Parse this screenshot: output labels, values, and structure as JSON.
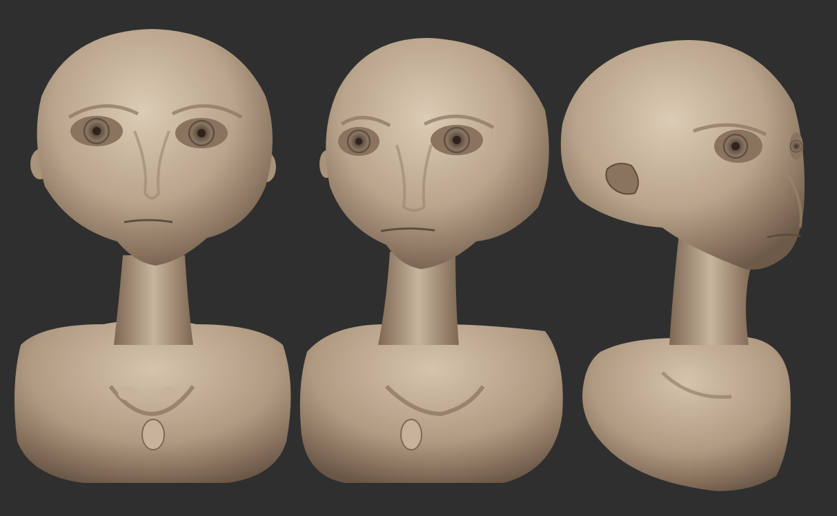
{
  "scene": {
    "background_color": "#2f2f2f",
    "clay_color": "#b9a48c",
    "clay_highlight": "#d8c7b1",
    "clay_shadow": "#6e5a48",
    "eye_color": "#5a4a3c"
  },
  "busts": [
    {
      "view": "front"
    },
    {
      "view": "three-quarter"
    },
    {
      "view": "side"
    }
  ]
}
